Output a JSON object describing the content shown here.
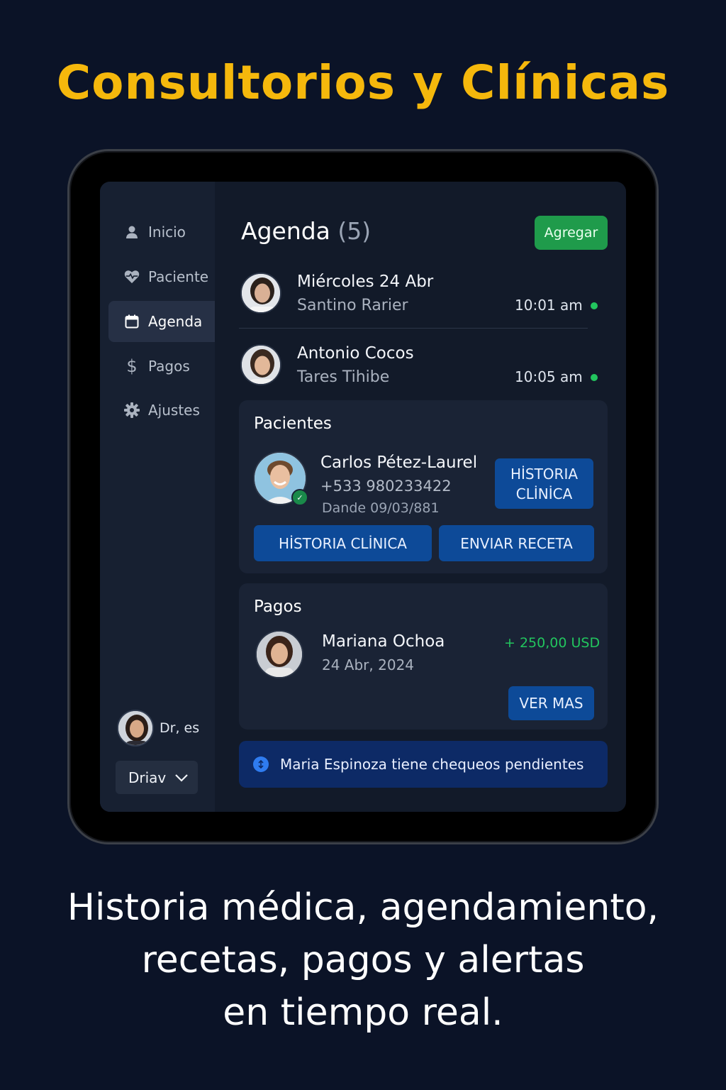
{
  "headline": "Consultorios y Clínicas",
  "sidebar": {
    "items": [
      {
        "label": "Inicio",
        "icon": "user-icon",
        "active": false
      },
      {
        "label": "Paciente",
        "icon": "heart-pulse-icon",
        "active": false
      },
      {
        "label": "Agenda",
        "icon": "calendar-icon",
        "active": true
      },
      {
        "label": "Pagos",
        "icon": "dollar-icon",
        "active": false
      },
      {
        "label": "Ajustes",
        "icon": "gear-icon",
        "active": false
      }
    ],
    "user_name": "Dr, es",
    "select_value": "Driav"
  },
  "agenda": {
    "title": "Agenda",
    "count": "(5)",
    "add_label": "Agregar",
    "appointments": [
      {
        "line1": "Miércoles 24  Abr",
        "line2": "Santino Rarier",
        "time": "10:01 am",
        "status_color": "#22c55e"
      },
      {
        "line1": "Antonio Cocos",
        "line2": "Tares Tihibe",
        "time": "10:05 am",
        "status_color": "#22c55e"
      }
    ]
  },
  "patients": {
    "title": "Pacientes",
    "name": "Carlos Pétez-Laurel",
    "phone": "+533 980233422",
    "date": "Dande 09/03/881",
    "side_button_line1": "HİSTORIA",
    "side_button_line2": "CLİNİCA",
    "history_button": "HİSTORIA CLİNICA",
    "prescription_button": "ENVIAR RECETA"
  },
  "payments": {
    "title": "Pagos",
    "name": "Mariana Ochoa",
    "date": "24 Abr, 2024",
    "amount": "+ 250,00 USD",
    "more_button": "VER MAS"
  },
  "alert": {
    "text": "Maria Espinoza tiene chequeos pendientes"
  },
  "caption": {
    "line1": "Historia  médica,  agendamiento,",
    "line2": "recetas,  pagos  y  alertas",
    "line3": "en  tiempo  real."
  },
  "colors": {
    "background": "#0b1327",
    "headline": "#f5b80c",
    "accent_green": "#1f9b4b",
    "button_blue": "#0d4a98",
    "alert_blue": "#0d2a66"
  }
}
